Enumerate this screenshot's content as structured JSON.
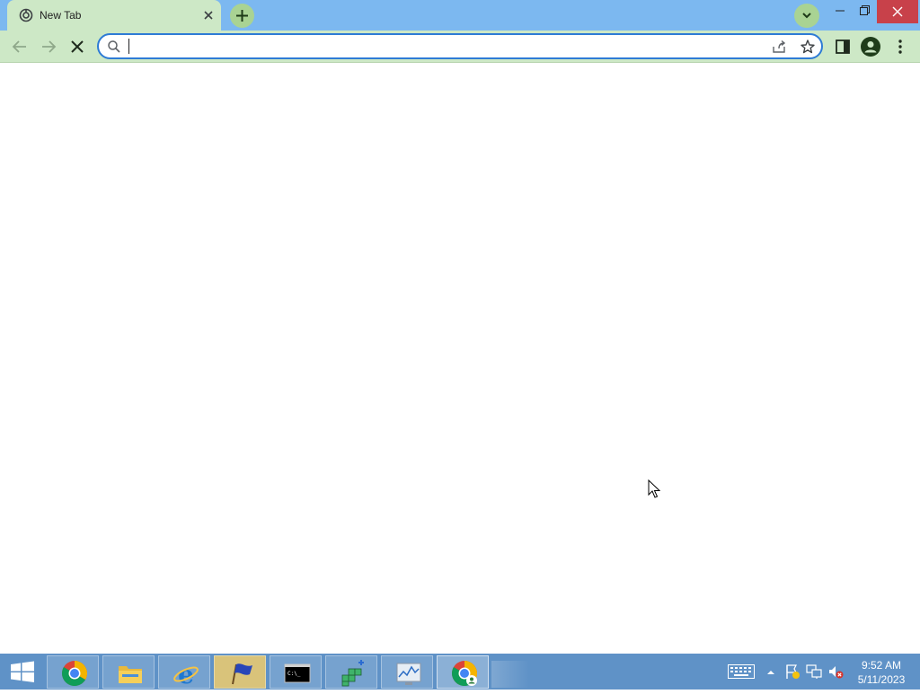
{
  "browser": {
    "tab": {
      "title": "New Tab"
    },
    "omnibox": {
      "value": "",
      "placeholder": ""
    },
    "accent_color": "#2e7bd5",
    "theme_color": "#cde8c6"
  },
  "icons": {
    "tab_favicon": "new-tab-favicon",
    "back": "arrow-left",
    "forward": "arrow-right",
    "stop": "x-stop",
    "search": "magnifier",
    "share": "share-arrow",
    "bookmark": "star-outline",
    "side_panel": "side-panel",
    "profile": "person",
    "menu": "three-dots"
  },
  "taskbar": {
    "apps": [
      {
        "name": "chrome",
        "active": false
      },
      {
        "name": "file-explorer",
        "active": false
      },
      {
        "name": "internet-explorer",
        "active": false
      },
      {
        "name": "flag-app",
        "active": false
      },
      {
        "name": "command-prompt",
        "active": false
      },
      {
        "name": "component-services",
        "active": false
      },
      {
        "name": "performance-monitor",
        "active": false
      },
      {
        "name": "chrome",
        "active": true
      }
    ],
    "clock": {
      "time": "9:52 AM",
      "date": "5/11/2023"
    }
  }
}
